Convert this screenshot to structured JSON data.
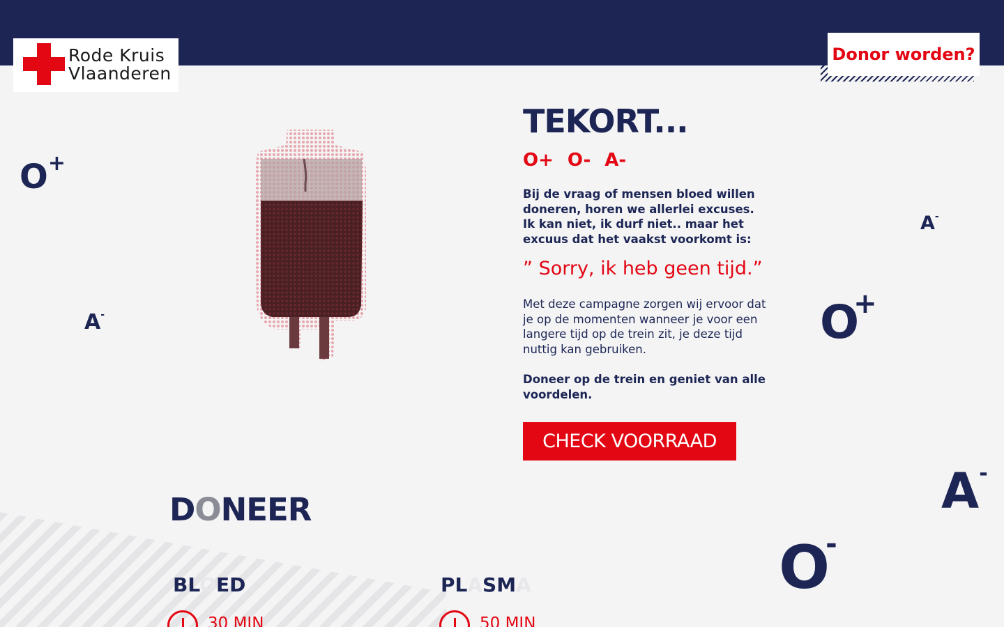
{
  "header": {
    "logo": {
      "line1": "Rode Kruis",
      "line2": "Vlaanderen"
    },
    "donor_button": "Donor worden?"
  },
  "decor": {
    "left_o": {
      "letter": "O",
      "sign": "+"
    },
    "left_a": {
      "letter": "A",
      "sign": "-"
    },
    "right_a_small": {
      "letter": "A",
      "sign": "-"
    },
    "right_o": {
      "letter": "O",
      "sign": "+"
    },
    "right_a_big": {
      "letter": "A",
      "sign": "-"
    },
    "right_o_minus": {
      "letter": "O",
      "sign": "-"
    }
  },
  "main": {
    "title": "TEKORT...",
    "blood_types": [
      "O+",
      "O-",
      "A-"
    ],
    "intro": "Bij de vraag of mensen bloed willen doneren, horen we allerlei excuses. Ik kan niet, ik durf niet.. maar het excuus dat het vaakst voorkomt is:",
    "quote": "” Sorry, ik heb geen tijd.”",
    "body": "Met deze campagne zorgen wij ervoor dat je op de momenten wanneer je voor een langere tijd op de trein zit, je deze tijd nuttig kan gebruiken.",
    "cta_text": "Doneer op de trein en geniet van alle voordelen.",
    "check_button": "CHECK VOORRAAD"
  },
  "doneer": {
    "heading_pre": "D",
    "heading_o": "O",
    "heading_post": "NEER",
    "bloed": {
      "label_a": "BL",
      "label_ghost": "O",
      "label_b": "ED",
      "time": "30 MIN"
    },
    "plasma": {
      "label_a": "PL",
      "label_ghost1": "A",
      "label_b": "SM",
      "label_ghost2": "A",
      "time": "50 MIN"
    }
  },
  "colors": {
    "navy": "#1c2554",
    "red": "#e30613",
    "background": "#f4f4f5"
  }
}
